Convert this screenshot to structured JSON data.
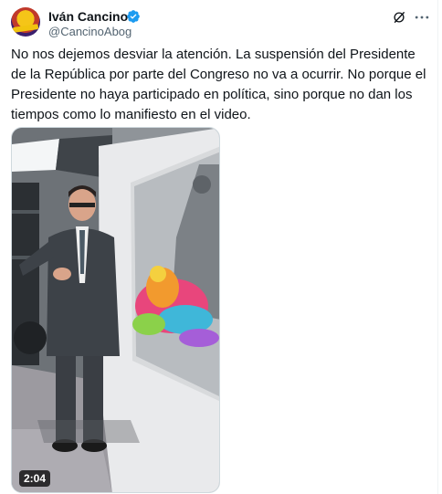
{
  "author": {
    "display_name": "Iván Cancino",
    "handle": "@CancinoAbog",
    "verified": true,
    "avatar_icon": "avatar-logo"
  },
  "icons": {
    "verified": "verified-badge-icon",
    "grok": "grok-icon",
    "more": "more-options-icon"
  },
  "tweet": {
    "text": "No nos dejemos desviar la atención. La suspensión del Presidente de la República por parte del Congreso no va a ocurrir. No porque el Presidente no haya participado en política, sino porque no dan los tiempos como lo manifiesto en el video."
  },
  "media": {
    "type": "video",
    "duration": "2:04"
  },
  "colors": {
    "text": "#0f1419",
    "secondary": "#536471",
    "verified": "#1d9bf0",
    "border": "#cfd9de"
  }
}
